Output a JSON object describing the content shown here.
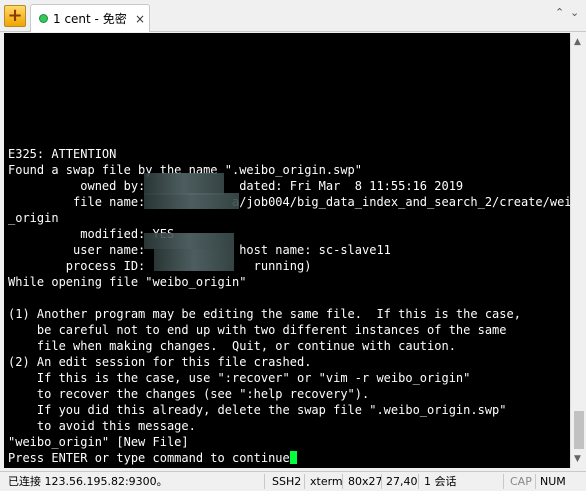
{
  "tabbar": {
    "new_tab_glyph": "+",
    "tab_title": "1 cent - 免密",
    "close_glyph": "×",
    "scroll_up_glyph": "⌃",
    "scroll_down_glyph": "⌄"
  },
  "terminal": {
    "lines": [
      "E325: ATTENTION",
      "Found a swap file by the name \".weibo_origin.swp\"",
      "          owned by:             dated: Fri Mar  8 11:55:16 2019",
      "         file name:            a/job004/big_data_index_and_search_2/create/weibo",
      "_origin",
      "          modified: YES",
      "         user name:             host name: sc-slave11",
      "        process ID:               running)",
      "While opening file \"weibo_origin\"",
      "",
      "(1) Another program may be editing the same file.  If this is the case,",
      "    be careful not to end up with two different instances of the same",
      "    file when making changes.  Quit, or continue with caution.",
      "(2) An edit session for this file crashed.",
      "    If this is the case, use \":recover\" or \"vim -r weibo_origin\"",
      "    to recover the changes (see \":help recovery\").",
      "    If you did this already, delete the swap file \".weibo_origin.swp\"",
      "    to avoid this message.",
      "\"weibo_origin\" [New File]"
    ],
    "prompt": "Press ENTER or type command to continue",
    "cursor_color": "#00ff3c"
  },
  "statusbar": {
    "connection": "已连接 123.56.195.82:9300。",
    "protocol": "SSH2",
    "term": "xterm",
    "size": "80x27",
    "position": "27,40",
    "sessions": "1 会话",
    "cap": "CAP",
    "num": "NUM"
  }
}
